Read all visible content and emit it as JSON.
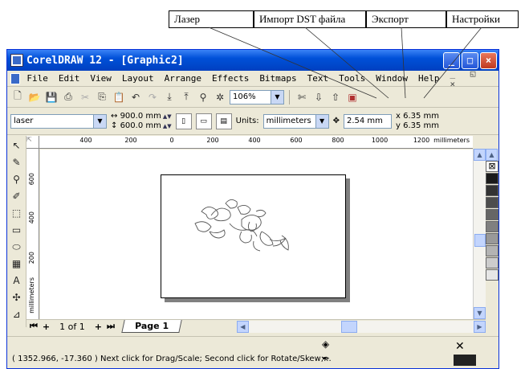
{
  "callouts": {
    "laser": "Лазер",
    "import_dst": "Импорт DST файла",
    "export": "Экспорт",
    "settings": "Настройки"
  },
  "window": {
    "title": "CorelDRAW 12 - [Graphic2]",
    "controls": {
      "minimize": "_",
      "maximize": "□",
      "close": "×"
    }
  },
  "menu": {
    "items": [
      "File",
      "Edit",
      "View",
      "Layout",
      "Arrange",
      "Effects",
      "Bitmaps",
      "Text",
      "Tools",
      "Window",
      "Help"
    ],
    "mdi_controls": "_ ◱ ×"
  },
  "toolbar": {
    "zoom": "106%"
  },
  "property_bar": {
    "preset": "laser",
    "width": "900.0 mm",
    "height": "600.0 mm",
    "units_label": "Units:",
    "units_value": "millimeters",
    "nudge": "2.54 mm",
    "dup_x": "6.35 mm",
    "dup_y": "6.35 mm"
  },
  "ruler": {
    "h_ticks": [
      "400",
      "200",
      "0",
      "200",
      "400",
      "600",
      "800",
      "1000",
      "1200"
    ],
    "v_ticks": [
      "600",
      "400",
      "200"
    ],
    "unit": "millimeters"
  },
  "pages": {
    "count_text": "1 of 1",
    "tab": "Page 1"
  },
  "palette": {
    "colors": [
      "#ffffff",
      "#1a1a1a",
      "#333333",
      "#4d4d4d",
      "#666666",
      "#808080",
      "#999999",
      "#b3b3b3",
      "#cccccc",
      "#e6e6e6"
    ]
  },
  "status": {
    "coords": "( 1352.966, -17.360 )",
    "message": "Next click for Drag/Scale; Second click for Rotate/Skew;..."
  }
}
